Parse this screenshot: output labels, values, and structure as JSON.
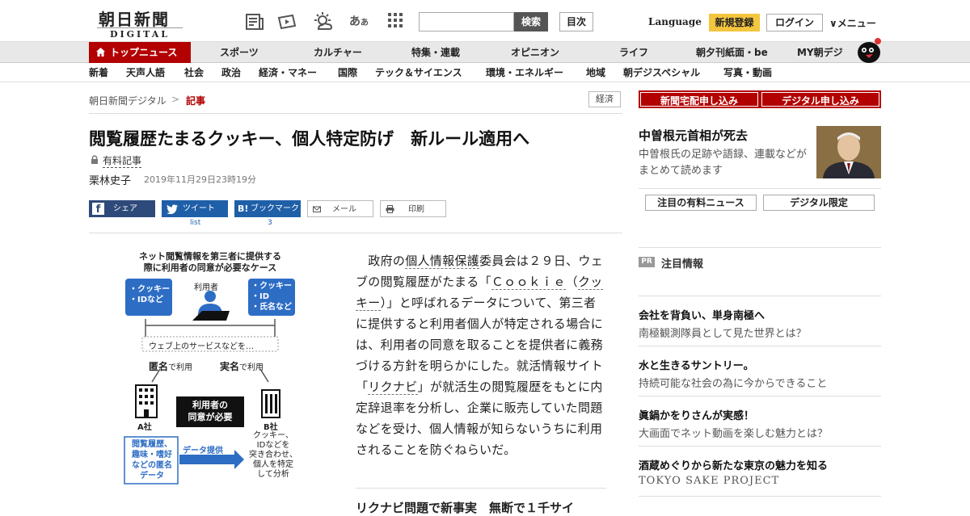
{
  "header": {
    "logo_main": "朝日新聞",
    "logo_sub": "DIGITAL",
    "search_placeholder": "",
    "search_button": "検索",
    "contents_button": "目次",
    "language": "Language",
    "register": "新規登録",
    "login": "ログイン",
    "menu": "∨メニュー"
  },
  "nav_primary": [
    "トップニュース",
    "スポーツ",
    "カルチャー",
    "特集・連載",
    "オピニオン",
    "ライフ",
    "朝夕刊紙面・be",
    "MY朝デジ"
  ],
  "nav_secondary": [
    "新着",
    "天声人語",
    "社会",
    "政治",
    "経済・マネー",
    "国際",
    "テック＆サイエンス",
    "環境・エネルギー",
    "地域",
    "朝デジスペシャル",
    "写真・動画"
  ],
  "breadcrumb": {
    "home": "朝日新聞デジタル",
    "sep": ">",
    "current": "記事"
  },
  "category_tag": "経済",
  "article": {
    "title": "閲覧履歴たまるクッキー、個人特定防げ　新ルール適用へ",
    "paid_label": "有料記事",
    "author": "栗林史子",
    "date": "2019年11月29日23時19分",
    "share": {
      "facebook": "シェア",
      "twitter": "ツイート",
      "twitter_sub": "list",
      "hatena": "ブックマーク",
      "hatena_sub": "3",
      "mail": "メール",
      "print": "印刷"
    },
    "body_parts": [
      "　政府の",
      "個人情報保護",
      "委員会は２９日、ウェブの閲覧履歴がたまる「",
      "Ｃｏｏｋｉｅ",
      "（",
      "クッキー",
      "）」と呼ばれるデータについて、第三者に提供すると利用者個人が特定される場合には、利用者の同意を取ることを提供者に義務づける方針を明らかにした。就活情報サイト「",
      "リクナビ",
      "」が就活生の閲覧履歴をもとに内定辞退率を分析し、企業に販売していた問題などを受け、個人情報が知らないうちに利用されることを防ぐねらいだ。"
    ],
    "next_heading": "リクナビ問題で新事実　無断で１千サイ"
  },
  "figure": {
    "title1": "ネット閲覧情報を第三者に提供する",
    "title2": "際に利用者の同意が必要なケース",
    "left_box": [
      "・クッキー",
      "・IDなど"
    ],
    "right_box": [
      "・クッキー",
      "・ID",
      "・氏名など"
    ],
    "user": "利用者",
    "service": "ウェブ上のサービスなどを…",
    "anon": "匿名",
    "use": "で利用",
    "real": "実名",
    "company_a": "A社",
    "company_b": "B社",
    "consent1": "利用者の",
    "consent2": "同意が必要",
    "data_a": [
      "閲覧履歴、",
      "趣味・嗜好",
      "などの匿名",
      "データ"
    ],
    "transfer": "データ提供",
    "b_text": [
      "クッキー、",
      "IDなどを",
      "突き合わせ、",
      "個人を特定",
      "して分析"
    ]
  },
  "sidebar": {
    "buttons": [
      "新聞宅配申し込み",
      "デジタル申し込み"
    ],
    "feature_title": "中曽根元首相が死去",
    "feature_desc": "中曽根氏の足跡や語録、連載などがまとめて読めます",
    "tabs": [
      "注目の有料ニュース",
      "デジタル限定"
    ],
    "pr_badge": "PR",
    "pr_title": "注目情報",
    "pr_items": [
      {
        "head": "会社を背負い、単身南極へ",
        "desc": "南極観測隊員として見た世界とは？"
      },
      {
        "head": "水と生きるサントリー。",
        "desc": "持続可能な社会の為に今からできること"
      },
      {
        "head": "眞鍋かをりさんが実感！",
        "desc": "大画面でネット動画を楽しむ魅力とは？"
      },
      {
        "head": "酒蔵めぐりから新たな東京の魅力を知る",
        "desc": "TOKYO SAKE PROJECT"
      }
    ]
  },
  "colors": {
    "brand_red": "#b30000",
    "accent_yellow": "#f4c53e",
    "share_blue": "#1f5fa8"
  }
}
